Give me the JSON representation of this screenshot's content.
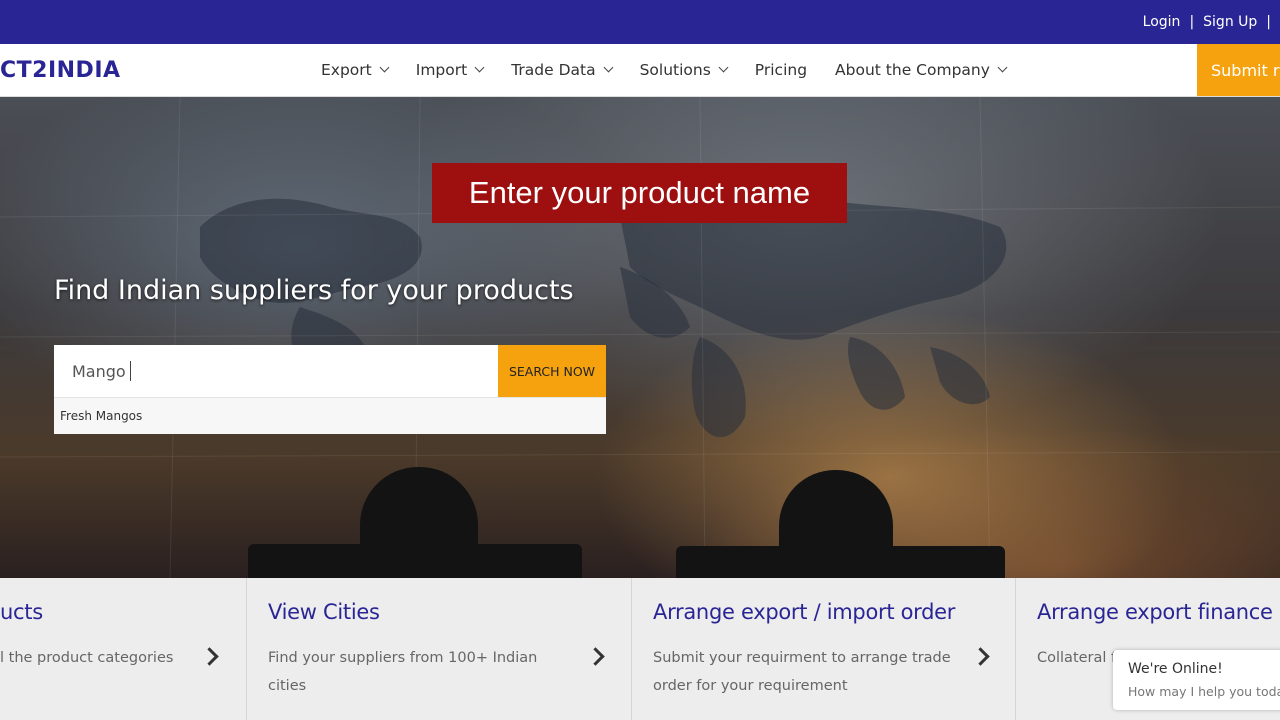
{
  "topbar": {
    "login": "Login",
    "separator": "|",
    "signup": "Sign Up"
  },
  "navbar": {
    "logo_text": "CT2INDIA",
    "items": [
      {
        "label": "Export",
        "dropdown": true
      },
      {
        "label": "Import",
        "dropdown": true
      },
      {
        "label": "Trade Data",
        "dropdown": true
      },
      {
        "label": "Solutions",
        "dropdown": true
      },
      {
        "label": "Pricing",
        "dropdown": false
      },
      {
        "label": "About the Company",
        "dropdown": true
      }
    ],
    "submit_label": "Submit re"
  },
  "hero": {
    "banner_text": "Enter your product name",
    "headline": "Find Indian suppliers for your products",
    "search": {
      "value": "Mango",
      "button_label": "SEARCH NOW"
    },
    "suggestions": [
      "Fresh Mangos"
    ]
  },
  "cards": [
    {
      "title": "ucts",
      "desc": "l the product categories"
    },
    {
      "title": "View Cities",
      "desc": "Find your suppliers from 100+ Indian cities"
    },
    {
      "title": "Arrange export / import order",
      "desc": "Submit your requirment to arrange trade order for your requirement"
    },
    {
      "title": "Arrange export finance",
      "desc": "Collateral fr"
    }
  ],
  "chat": {
    "status": "We're Online!",
    "prompt": "How may I help you today"
  },
  "colors": {
    "brand": "#2a2595",
    "accent": "#f6a20f",
    "banner": "#9e0f0f"
  }
}
